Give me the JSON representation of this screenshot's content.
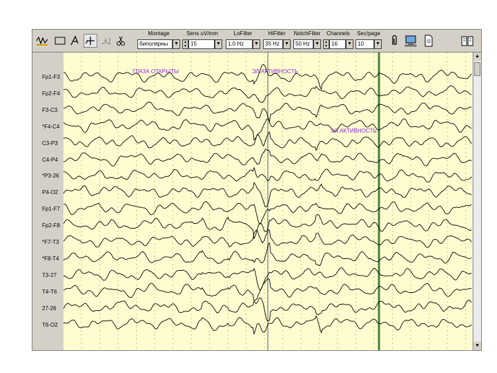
{
  "toolbar": {
    "controls": {
      "montage": {
        "label": "Montage",
        "value": "биполярны"
      },
      "sens": {
        "label": "Sens uV/mm",
        "value": "15"
      },
      "lofilter": {
        "label": "LoFilter",
        "value": "1.0 Hz"
      },
      "hifilter": {
        "label": "HiFilter",
        "value": "35 Hz"
      },
      "notchfilter": {
        "label": "NotchFilter",
        "value": "50 Hz"
      },
      "channels": {
        "label": "Channels",
        "value": "16"
      },
      "secpage": {
        "label": "Sec/page",
        "value": "10"
      }
    }
  },
  "channels": [
    "Fp1-F3",
    "Fp2-F4",
    "F3-C3",
    "*F4-C4",
    "C3-P3",
    "C4-P4",
    "*P3-26",
    "P4-O2",
    "Fp1-F7",
    "Fp2-F8",
    "*F7-T3",
    "*F8-T4",
    "T3-27",
    "T4-T6",
    "27-26",
    "T6-O2"
  ],
  "annotations": {
    "eyes_open": "ГЛАЗА ОТКРЫТЫ",
    "artifact1": "ЭЛ.АКТИВНОСТЬ",
    "artifact2": "ЭЛ.АКТИВНОСТЬ"
  },
  "colors": {
    "plot_bg": "#fffdd0",
    "marker": "#4a7a3a",
    "trace": "#000000",
    "annotation": "#8a2be2"
  }
}
